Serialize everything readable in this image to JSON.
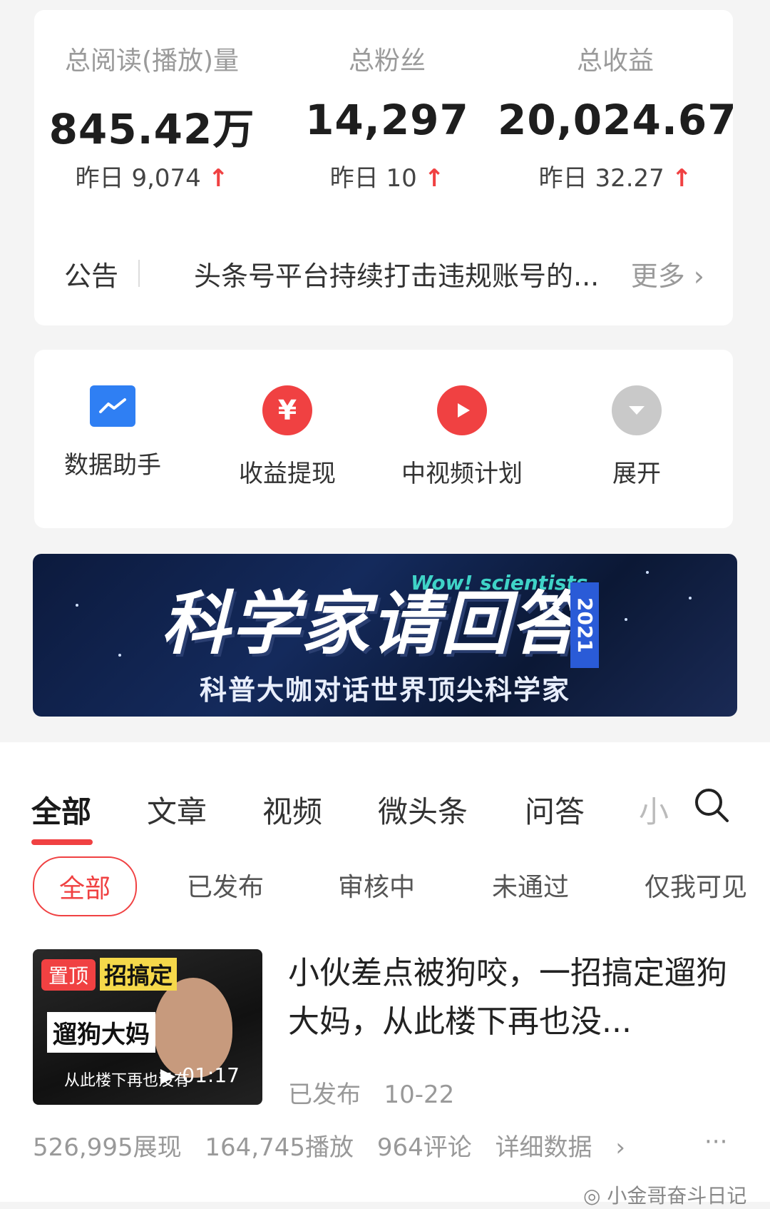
{
  "stats": [
    {
      "label": "总阅读(播放)量",
      "value": "845.42万",
      "yesterday": "昨日 9,074",
      "trend_icon": "up-arrow-icon"
    },
    {
      "label": "总粉丝",
      "value": "14,297",
      "yesterday": "昨日 10",
      "trend_icon": "up-arrow-icon"
    },
    {
      "label": "总收益",
      "value": "20,024.67",
      "yesterday": "昨日 32.27",
      "trend_icon": "up-arrow-icon"
    }
  ],
  "notice": {
    "label": "公告",
    "text": "头条号平台持续打击违规账号的...",
    "more": "更多"
  },
  "tools": [
    {
      "label": "数据助手",
      "icon": "data-chart-icon",
      "color": "#2f7ff3"
    },
    {
      "label": "收益提现",
      "icon": "yuan-icon",
      "color": "#f04142"
    },
    {
      "label": "中视频计划",
      "icon": "play-icon",
      "color": "#f04142"
    },
    {
      "label": "展开",
      "icon": "expand-chevron-icon",
      "color": "#c9c9c9"
    }
  ],
  "banner": {
    "title": "科学家请回答",
    "wow": "Wow! scientists",
    "year": "2021",
    "subtitle": "科普大咖对话世界顶尖科学家"
  },
  "tabs": [
    "全部",
    "文章",
    "视频",
    "微头条",
    "问答",
    "小"
  ],
  "filters": [
    "全部",
    "已发布",
    "审核中",
    "未通过",
    "仅我可见"
  ],
  "post": {
    "badge": "置顶",
    "thumb_text1": "招搞定",
    "thumb_text2": "遛狗大妈",
    "thumb_sub": "从此楼下再也没有",
    "duration": "01:17",
    "title": "小伙差点被狗咬，一招搞定遛狗大妈，从此楼下再也没...",
    "status": "已发布",
    "date": "10-22",
    "impressions": "526,995展现",
    "plays": "164,745播放",
    "comments": "964评论",
    "details": "详细数据",
    "more": "···"
  },
  "watermark": "小金哥奋斗日记",
  "colors": {
    "accent": "#f04142",
    "blue": "#2f7ff3",
    "muted": "#999999"
  }
}
